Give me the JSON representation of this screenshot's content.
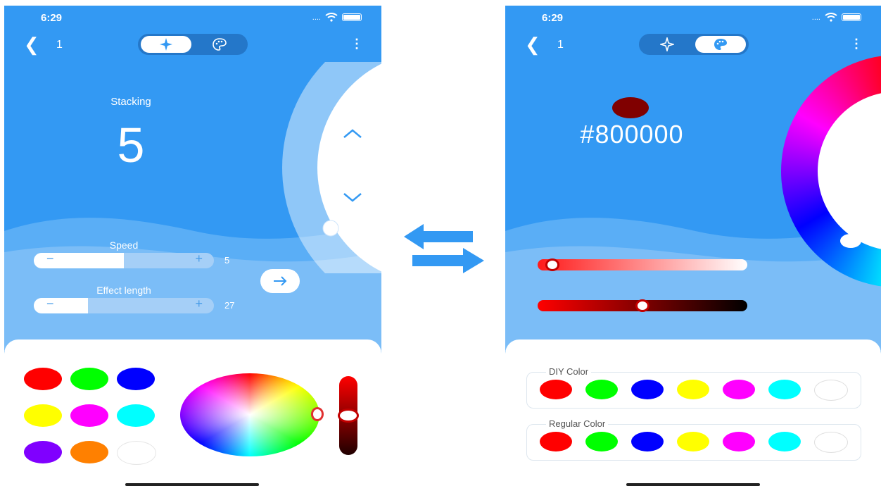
{
  "left": {
    "status_time": "6:29",
    "status_signal": "....",
    "device_name": "1",
    "stacking_label": "Stacking",
    "stacking_value": "5",
    "speed_label": "Speed",
    "speed_value": "5",
    "speed_level": 0.5,
    "effect_length_label": "Effect length",
    "effect_length_value": "27",
    "effect_length_level": 0.3,
    "slider_minus": "−",
    "slider_plus": "+",
    "palette_colors": [
      "#ff0000",
      "#00ff00",
      "#0000ff",
      "#ffff00",
      "#ff00ff",
      "#00ffff",
      "#8000ff",
      "#ff8000",
      "#ffffff"
    ],
    "active_tab": "effects",
    "icons": [
      "back-icon",
      "sparkle-icon",
      "palette-icon",
      "more-icon",
      "chevron-up-icon",
      "chevron-down-icon",
      "arrow-right-icon"
    ]
  },
  "right": {
    "status_time": "6:29",
    "status_signal": "....",
    "device_name": "1",
    "hex_value": "#800000",
    "current_color": "#800000",
    "saturation_level": 0.04,
    "brightness_level": 0.5,
    "diy_title": "DIY Color",
    "regular_title": "Regular Color",
    "diy_colors": [
      "#ff0000",
      "#00ff00",
      "#0000ff",
      "#ffff00",
      "#ff00ff",
      "#00ffff",
      "#ffffff"
    ],
    "regular_colors": [
      "#ff0000",
      "#00ff00",
      "#0000ff",
      "#ffff00",
      "#ff00ff",
      "#00ffff",
      "#ffffff"
    ],
    "active_tab": "color",
    "icons": [
      "back-icon",
      "sparkle-icon",
      "palette-icon",
      "more-icon"
    ]
  },
  "theme": {
    "primary": "#3399f3",
    "dark_toggle": "#2477c9",
    "light_wave": "#a5cff7"
  },
  "center": {
    "icon": "swap-arrows-icon"
  }
}
